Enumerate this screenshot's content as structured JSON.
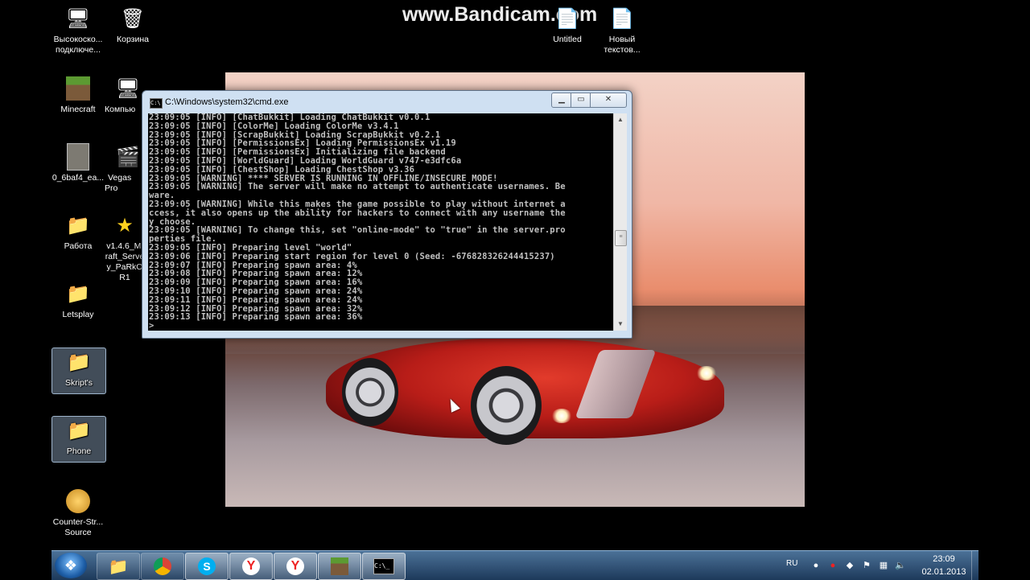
{
  "watermark": "www.Bandicam.com",
  "desktop_icons": [
    {
      "label": "Высокоско... подключе...",
      "icon": "network-connection-icon"
    },
    {
      "label": "Корзина",
      "icon": "recycle-bin-icon"
    },
    {
      "label": "Minecraft",
      "icon": "minecraft-icon"
    },
    {
      "label": "Компью",
      "icon": "computer-icon"
    },
    {
      "label": "0_6baf4_ea...",
      "icon": "image-file-icon"
    },
    {
      "label": "Vegas Pro",
      "icon": "vegas-pro-icon"
    },
    {
      "label": "Работа",
      "icon": "folder-icon"
    },
    {
      "label": "v1.4.6_Mi raft_Serve y_PaRkO R1",
      "icon": "star-icon"
    },
    {
      "label": "Letsplay",
      "icon": "folder-icon"
    },
    {
      "label": "Skript's",
      "icon": "folder-icon"
    },
    {
      "label": "Phone",
      "icon": "folder-icon"
    },
    {
      "label": "Counter-Str... Source",
      "icon": "counter-strike-icon"
    },
    {
      "label": "Untitled",
      "icon": "file-icon"
    },
    {
      "label": "Новый текстов...",
      "icon": "text-document-icon"
    }
  ],
  "cmd": {
    "title": "C:\\Windows\\system32\\cmd.exe",
    "lines": [
      "23:09:05 [INFO] [ChatBukkit] Loading ChatBukkit v0.0.1",
      "23:09:05 [INFO] [ColorMe] Loading ColorMe v3.4.1",
      "23:09:05 [INFO] [ScrapBukkit] Loading ScrapBukkit v0.2.1",
      "23:09:05 [INFO] [PermissionsEx] Loading PermissionsEx v1.19",
      "23:09:05 [INFO] [PermissionsEx] Initializing file backend",
      "23:09:05 [INFO] [WorldGuard] Loading WorldGuard v747-e3dfc6a",
      "23:09:05 [INFO] [ChestShop] Loading ChestShop v3.36",
      "23:09:05 [WARNING] **** SERVER IS RUNNING IN OFFLINE/INSECURE MODE!",
      "23:09:05 [WARNING] The server will make no attempt to authenticate usernames. Be",
      "ware.",
      "23:09:05 [WARNING] While this makes the game possible to play without internet a",
      "ccess, it also opens up the ability for hackers to connect with any username the",
      "y choose.",
      "23:09:05 [WARNING] To change this, set \"online-mode\" to \"true\" in the server.pro",
      "perties file.",
      "23:09:05 [INFO] Preparing level \"world\"",
      "23:09:06 [INFO] Preparing start region for level 0 (Seed: -676828326244415237)",
      "23:09:07 [INFO] Preparing spawn area: 4%",
      "23:09:08 [INFO] Preparing spawn area: 12%",
      "23:09:09 [INFO] Preparing spawn area: 16%",
      "23:09:10 [INFO] Preparing spawn area: 24%",
      "23:09:11 [INFO] Preparing spawn area: 24%",
      "23:09:12 [INFO] Preparing spawn area: 32%",
      "23:09:13 [INFO] Preparing spawn area: 36%",
      ">"
    ]
  },
  "taskbar": {
    "buttons": [
      {
        "icon": "file-explorer-icon"
      },
      {
        "icon": "chrome-icon"
      },
      {
        "icon": "skype-icon"
      },
      {
        "icon": "yandex-browser-icon"
      },
      {
        "icon": "yandex-browser-icon"
      },
      {
        "icon": "minecraft-icon"
      },
      {
        "icon": "cmd-icon"
      }
    ],
    "tray": {
      "language": "RU",
      "time": "23:09",
      "date": "02.01.2013"
    }
  },
  "colors": {
    "console_bg": "#000000",
    "console_text": "#c0c0c0",
    "taskbar": "#2a5580"
  }
}
